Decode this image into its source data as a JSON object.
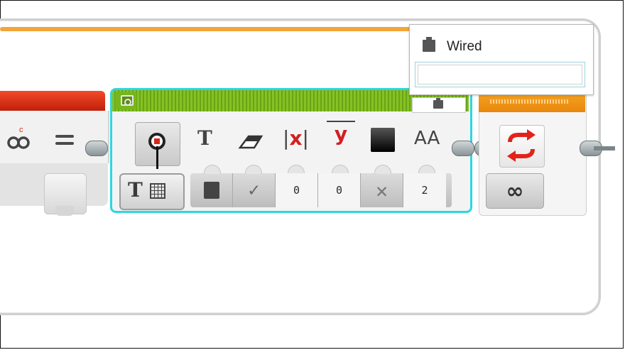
{
  "popup": {
    "item_label": "Wired",
    "input_value": ""
  },
  "left_block": {
    "variable_label": "c"
  },
  "display_block": {
    "params": [
      {
        "name": "battery-param",
        "value": ""
      },
      {
        "name": "clear-param",
        "value": ""
      },
      {
        "name": "x-param",
        "value": "0"
      },
      {
        "name": "y-param",
        "value": "0"
      },
      {
        "name": "color-param",
        "value": ""
      },
      {
        "name": "font-param",
        "value": "2"
      }
    ],
    "icon_labels": {
      "text": "T",
      "x": "x",
      "y": "y",
      "font": "AA"
    }
  },
  "loop_block": {
    "mode_label": "∞"
  },
  "colors": {
    "accent_cyan": "#2fd6e0",
    "block_green": "#7cb51c",
    "block_red": "#e0300f",
    "block_orange": "#f29a1c",
    "loop_border": "#cfcfcf"
  }
}
